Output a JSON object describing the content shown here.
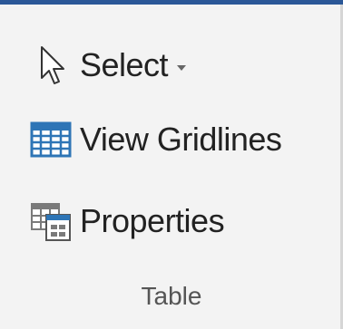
{
  "commands": {
    "select": {
      "label": "Select",
      "icon": "cursor-arrow-icon",
      "has_dropdown": true
    },
    "gridlines": {
      "label": "View Gridlines",
      "icon": "table-grid-icon"
    },
    "properties": {
      "label": "Properties",
      "icon": "table-properties-icon"
    }
  },
  "group": {
    "label": "Table"
  },
  "colors": {
    "accent": "#2b5797",
    "icon_blue": "#2e75b6",
    "background": "#f3f3f3",
    "text": "#222222"
  }
}
